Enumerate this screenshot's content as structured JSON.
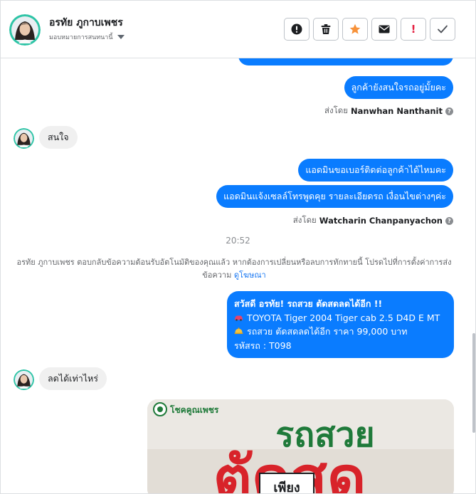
{
  "header": {
    "contact_name": "อรทัย ภูกาบเพชร",
    "assign_label": "มอบหมายการสนทนานี้",
    "actions": [
      {
        "name": "spam-icon",
        "color": "#1c1e21"
      },
      {
        "name": "trash-icon",
        "color": "#1c1e21"
      },
      {
        "name": "star-icon",
        "color": "#f7923a"
      },
      {
        "name": "mail-icon",
        "color": "#1c1e21"
      },
      {
        "name": "important-icon",
        "color": "#e41e3f"
      },
      {
        "name": "check-icon",
        "color": "#1c1e21"
      }
    ]
  },
  "messages": {
    "out_1": "ลูกค้ายังสนใจรถอยู่มั้ยคะ",
    "sent_by_label": "ส่งโดย",
    "sent_by_1": "Nanwhan Nanthanit",
    "in_1": "สนใจ",
    "out_2": "แอดมินขอเบอร์ติดต่อลูกค้าได้ไหมคะ",
    "out_3": "แอดมินแจ้งเซลล์โทรพูดคุย รายละเอียดรถ เงื่อนไขต่างๆค่ะ",
    "sent_by_2": "Watcharin Chanpanyachon",
    "time": "20:52",
    "notice_text": "อรทัย ภูกาบเพชร ตอบกลับข้อความต้อนรับอัตโนมัติของคุณแล้ว หากต้องการเปลี่ยนหรือลบการทักทายนี้ โปรดไปที่การตั้งค่าการส่งข้อความ",
    "notice_link": "ดูโฆษณา",
    "promo": {
      "line1": "สวัสดี อรทัย! รถสวย ตัดสดลดได้อีก !!",
      "line2": "TOYOTA Tiger 2004 Tiger cab 2.5 D4D E MT",
      "line3": "รถสวย ตัดสดลดได้อีก ราคา 99,000 บาท",
      "line4": "รหัสรถ : T098"
    },
    "in_2": "ลดได้เท่าไหร่",
    "image": {
      "badge": "โชคคูณเพชร",
      "headline1": "รถสวย",
      "headline2": "ตัดสด",
      "tag": "เพียง"
    }
  },
  "colors": {
    "accent": "#0a7cff",
    "incoming": "#f0f0f0",
    "green_text": "#1f7a3a",
    "red_text": "#d8232a"
  }
}
